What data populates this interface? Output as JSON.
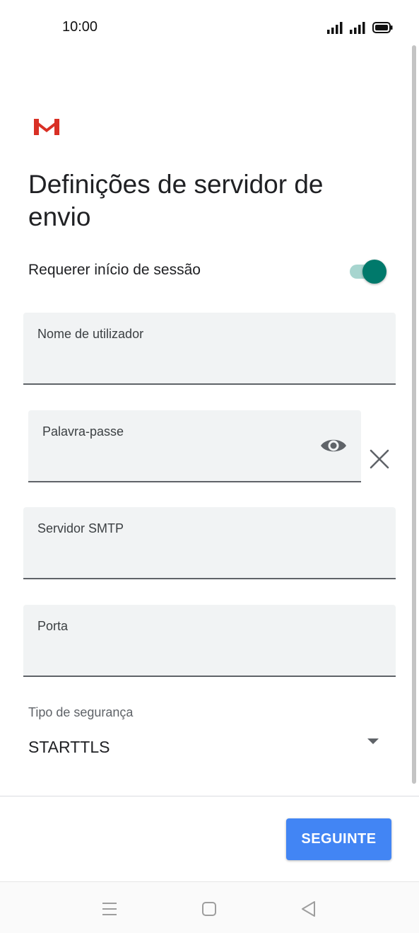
{
  "status_bar": {
    "time": "10:00",
    "icons": [
      "signal-icon",
      "signal-icon",
      "battery-icon"
    ]
  },
  "app": {
    "logo_icon": "gmail-logo-icon",
    "title": "Definições de servidor de envio"
  },
  "login_toggle": {
    "label": "Requerer início de sessão",
    "checked": true
  },
  "fields": {
    "username": {
      "label": "Nome de utilizador",
      "value": ""
    },
    "password": {
      "label": "Palavra-passe",
      "value": "",
      "show_icon": "eye-icon",
      "clear_icon": "close-icon"
    },
    "smtp_server": {
      "label": "Servidor SMTP",
      "value": ""
    },
    "port": {
      "label": "Porta",
      "value": ""
    }
  },
  "security": {
    "label": "Tipo de segurança",
    "value": "STARTTLS",
    "arrow_icon": "dropdown-arrow-icon"
  },
  "actions": {
    "next_label": "SEGUINTE"
  },
  "nav_bar": {
    "icons": [
      "menu-icon",
      "home-icon",
      "back-icon"
    ]
  },
  "colors": {
    "accent": "#00796b",
    "toggle_track": "#a7d5cf",
    "button_blue": "#4285f4",
    "field_bg": "#f1f3f4",
    "gmail_red": "#d93025"
  }
}
